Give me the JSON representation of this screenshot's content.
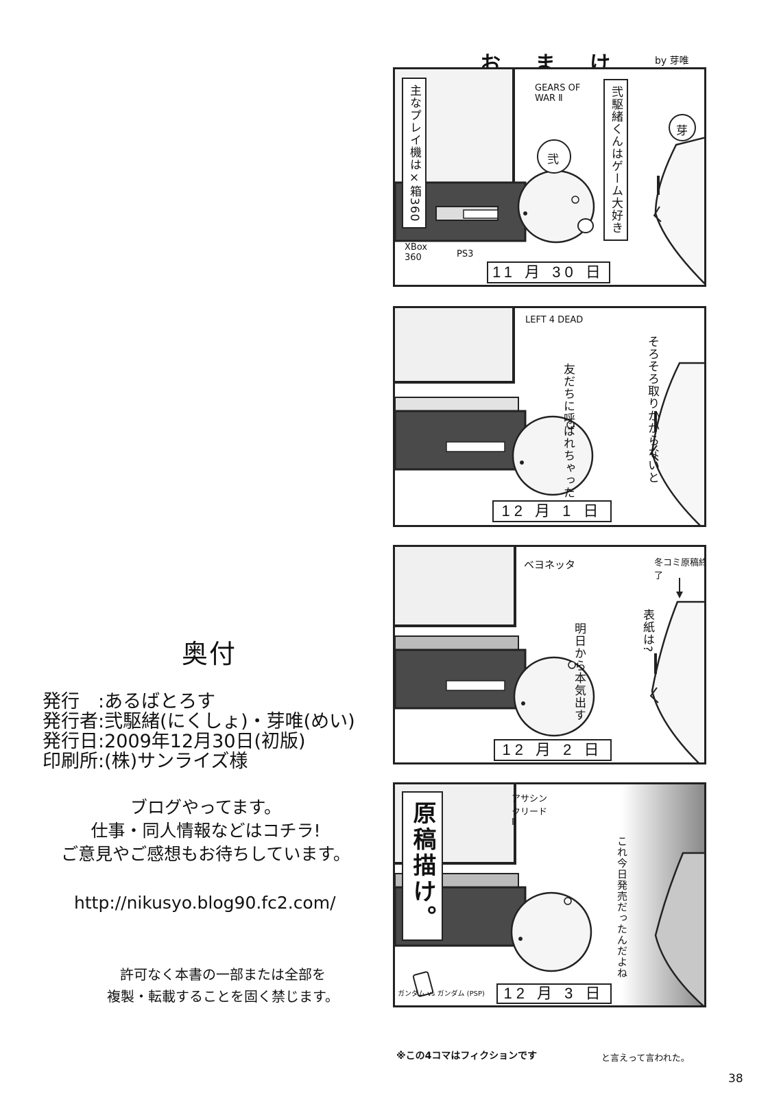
{
  "colophon": {
    "title": "奥付",
    "rows": [
      "発行　:あるばとろす",
      "発行者:弐駆緒(にくしょ)・芽唯(めい)",
      "発行日:2009年12月30日(初版)",
      "印刷所:(株)サンライズ様"
    ],
    "blog_lines": [
      "ブログやってます。",
      "仕事・同人情報などはコチラ!",
      "ご意見やご感想もお待ちしています。"
    ],
    "url": "http://nikusyo.blog90.fc2.com/",
    "legal_lines": [
      "許可なく本書の一部または全部を",
      "複製・転載することを固く禁じます。"
    ]
  },
  "comic": {
    "title": "おまけ",
    "by": "by 芽唯",
    "panels": [
      {
        "date": "11 月 30 日",
        "tv_label": "GEARS OF WAR Ⅱ",
        "box_left": "主なプレイ機は×箱360",
        "box_right": "弐駆緒くんはゲーム大好き",
        "head_left": "弐",
        "head_right": "芽",
        "label_a": "XBox 360",
        "label_b": "PS3"
      },
      {
        "date": "12 月 1 日",
        "tv_label": "LEFT 4 DEAD",
        "speech_left": "友だちに呼ばれちゃった",
        "speech_right": "そろそろ取りかからないと"
      },
      {
        "date": "12 月 2 日",
        "tv_label": "ベヨネッタ",
        "speech_left": "明日から本気出す",
        "speech_right": "表紙は?",
        "note_top": "冬コミ原稿終了"
      },
      {
        "date": "12 月 3 日",
        "tv_label": "アサシン クリード Ⅱ",
        "big_text": "原稿描け。",
        "speech_left": "これ今日発売だったんだよね",
        "label_psp": "ガンダム vs ガンダム (PSP)"
      }
    ],
    "footnote": "※この4コマはフィクションです",
    "footnote2": "と言えって言われた。"
  },
  "page_number": "38"
}
